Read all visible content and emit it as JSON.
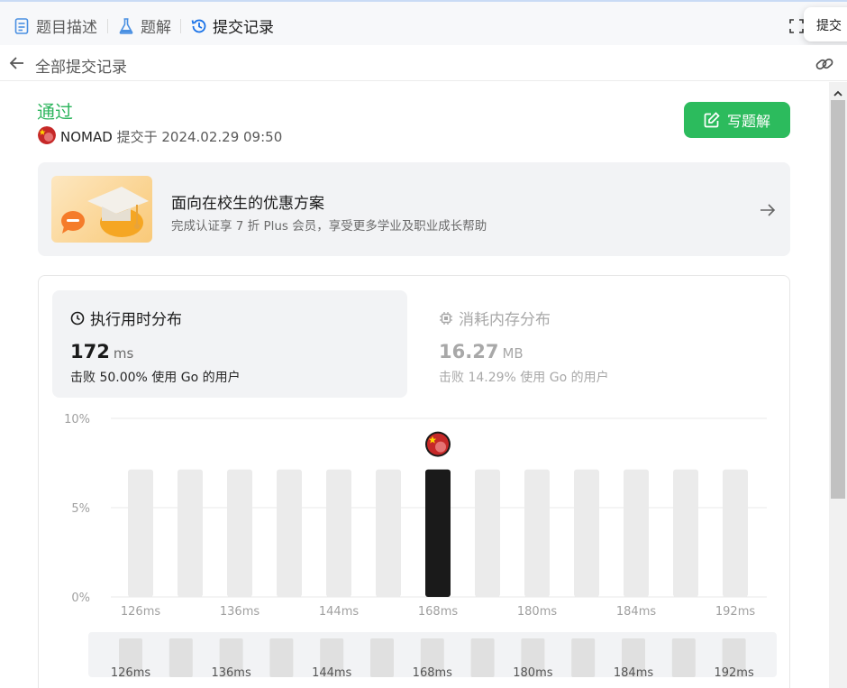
{
  "tabs": [
    {
      "label": "题目描述",
      "icon": "document-icon",
      "active": false
    },
    {
      "label": "题解",
      "icon": "flask-icon",
      "active": false
    },
    {
      "label": "提交记录",
      "icon": "history-icon",
      "active": true
    }
  ],
  "tooltip": "提交",
  "backbar": {
    "label": "全部提交记录"
  },
  "submission": {
    "status": "通过",
    "user": "NOMAD",
    "submitted_prefix": "提交于",
    "datetime": "2024.02.29 09:50",
    "write_solution_label": "写题解"
  },
  "promo": {
    "title": "面向在校生的优惠方案",
    "subtitle": "完成认证享 7 折 Plus 会员，享受更多学业及职业成长帮助"
  },
  "metrics": {
    "runtime": {
      "title": "执行用时分布",
      "value": "172",
      "unit": "ms",
      "beat_prefix": "击败",
      "beat_pct": "50.00%",
      "beat_suffix": "使用 Go 的用户"
    },
    "memory": {
      "title": "消耗内存分布",
      "value": "16.27",
      "unit": "MB",
      "beat_prefix": "击败",
      "beat_pct": "14.29%",
      "beat_suffix": "使用 Go 的用户"
    }
  },
  "colors": {
    "accent_green": "#2cbb5d",
    "bar_inactive": "#ebebeb",
    "bar_active": "#1a1a1a"
  },
  "chart_data": {
    "type": "bar",
    "yticks": [
      "10%",
      "5%",
      "0%"
    ],
    "ylim": [
      0,
      10
    ],
    "values": [
      7.14,
      7.14,
      7.14,
      7.14,
      7.14,
      7.14,
      7.14,
      7.14,
      7.14,
      7.14,
      7.14,
      7.14,
      7.14
    ],
    "highlight_index": 6,
    "xtick_labels": [
      "126ms",
      "136ms",
      "144ms",
      "168ms",
      "180ms",
      "184ms",
      "192ms"
    ],
    "minimap_values": [
      7.14,
      7.14,
      7.14,
      7.14,
      7.14,
      7.14,
      7.14,
      7.14,
      7.14,
      7.14,
      7.14,
      7.14,
      7.14
    ]
  }
}
